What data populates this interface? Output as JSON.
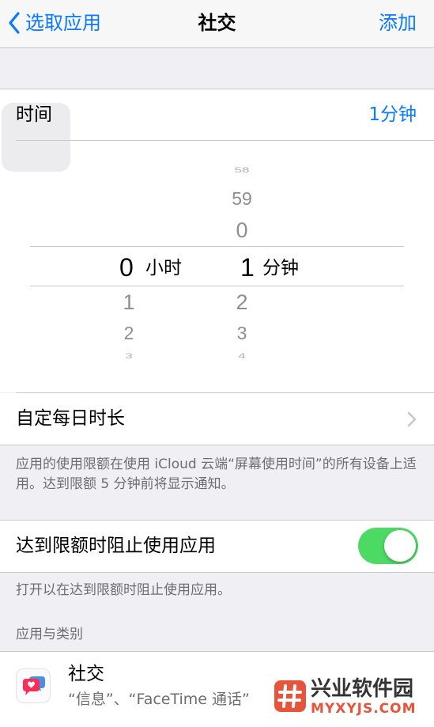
{
  "nav": {
    "back_label": "选取应用",
    "title": "社交",
    "add_label": "添加"
  },
  "time_row": {
    "label": "时间",
    "value": "1分钟"
  },
  "picker": {
    "hours": {
      "above": [],
      "selected": "0",
      "unit": "小时",
      "below": [
        "1",
        "2",
        "3"
      ]
    },
    "minutes": {
      "above": [
        "58",
        "59",
        "0"
      ],
      "selected": "1",
      "unit": "分钟",
      "below": [
        "2",
        "3",
        "4"
      ]
    }
  },
  "custom_days": {
    "label": "自定每日时长"
  },
  "note1": "应用的使用限额在使用 iCloud 云端“屏幕使用时间”的所有设备上适用。达到限额 5 分钟前将显示通知。",
  "block_row": {
    "label": "达到限额时阻止使用应用",
    "toggle_on": true
  },
  "note2": "打开以在达到限额时阻止使用应用。",
  "section_header": "应用与类别",
  "app_item": {
    "title": "社交",
    "subtitle": "“信息”、“FaceTime 通话”"
  },
  "watermark": {
    "text": "兴业软件园",
    "domain": "MYXYJS.COM"
  },
  "colors": {
    "accent": "#0a7aff",
    "toggle_on": "#4cd964",
    "background": "#efeff4",
    "secondary_text": "#6d6d72",
    "picker_dim_text": "#8e8e93",
    "watermark_red": "#e8543b"
  },
  "icons": {
    "back": "chevron-left-icon",
    "disclosure": "chevron-right-icon",
    "app": "speech-bubbles-icon",
    "watermark_logo": "hash-logo-icon"
  }
}
